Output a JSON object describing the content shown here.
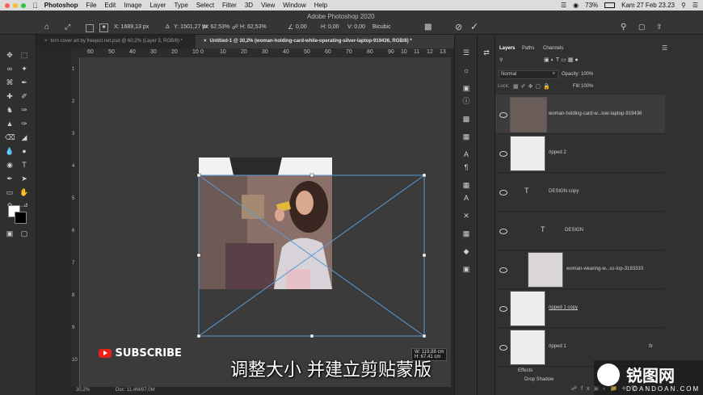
{
  "menubar": {
    "app": "Photoshop",
    "items": [
      "File",
      "Edit",
      "Image",
      "Layer",
      "Type",
      "Select",
      "Filter",
      "3D",
      "View",
      "Window",
      "Help"
    ],
    "battery": "73%",
    "datetime": "Kam 27 Feb  23.23"
  },
  "options": {
    "window_title": "Adobe Photoshop 2020",
    "x": "X: 1689,13 px",
    "y": "Y: 1501,27 px",
    "w": "W: 62,53%",
    "h": "H: 62,53%",
    "angle": "0,00",
    "h_skew": "H: 0,00",
    "v_skew": "V: 0,00",
    "interp": "Bicubic"
  },
  "tabs": [
    {
      "label": "torn cover art by freeject.net.psd @ 60,2% (Layer 3, RGB/8) *",
      "active": false
    },
    {
      "label": "Untitled-1 @ 30,2% (woman-holding-card-while-operating-silver-laptop-919436, RGB/8) *",
      "active": true
    }
  ],
  "ruler_top": [
    "60",
    "50",
    "40",
    "30",
    "20",
    "10",
    "0",
    "10",
    "20",
    "30",
    "40",
    "50",
    "60",
    "70",
    "80",
    "90",
    "10",
    "11",
    "12",
    "13"
  ],
  "ruler_left": [
    "1",
    "2",
    "3",
    "4",
    "5",
    "6",
    "7",
    "8",
    "9",
    "10"
  ],
  "status": {
    "zoom": "30,2%",
    "doc": "Doc: 11,4M/67,0M"
  },
  "transform_readout": {
    "w": "W: 119,88 cm",
    "h": "H: 67,41 cm"
  },
  "panel_tabs": [
    "Layers",
    "Paths",
    "Channels"
  ],
  "blend_mode": "Normal",
  "opacity_label": "Opacity:",
  "opacity": "100%",
  "fill_label": "Fill:",
  "fill": "100%",
  "lock_label": "Lock:",
  "layers": [
    {
      "name": "woman-holding-card-w...lver-laptop-919436",
      "kind": "image",
      "selected": true
    },
    {
      "name": "ripped 2",
      "kind": "paper"
    },
    {
      "name": "DESIGN copy",
      "kind": "text"
    },
    {
      "name": "DESIGN",
      "kind": "text"
    },
    {
      "name": "woman-wearing-w...ss-top-3193333",
      "kind": "image"
    },
    {
      "name": "ripped 1 copy",
      "kind": "paper"
    },
    {
      "name": "ripped 1",
      "kind": "paper",
      "fx": "fx"
    }
  ],
  "effects": {
    "label": "Effects",
    "drop_shadow": "Drop Shadow"
  },
  "overlay": {
    "subscribe": "SUBSCRIBE",
    "subtitle": "调整大小 并建立剪贴蒙版",
    "watermark_text": "锐图网",
    "watermark_url": "DOANDOAN.COM"
  },
  "colors": {
    "accent": "#5b9bd5",
    "bg": "#282828",
    "panel": "#313131"
  }
}
